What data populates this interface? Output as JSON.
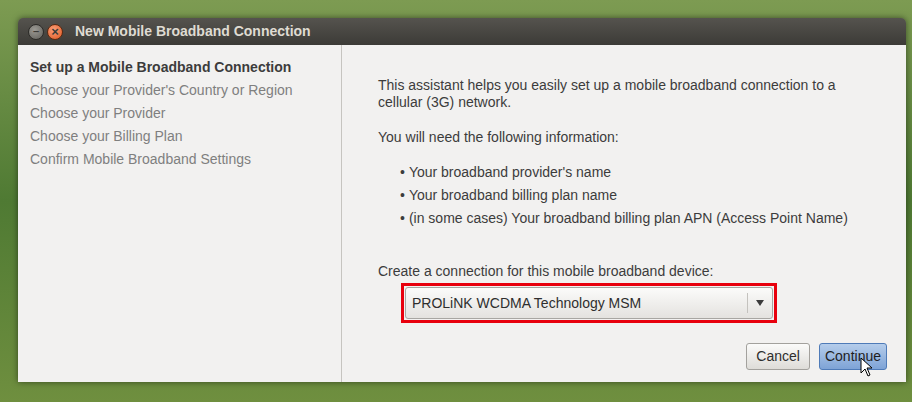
{
  "window": {
    "title": "New Mobile Broadband Connection",
    "buttons": [
      {
        "name": "minimize",
        "glyph": "–"
      },
      {
        "name": "close",
        "glyph": "×"
      }
    ]
  },
  "sidebar": {
    "items": [
      {
        "label": "Set up a Mobile Broadband Connection",
        "selected": true
      },
      {
        "label": "Choose your Provider's Country or Region",
        "selected": false
      },
      {
        "label": "Choose your Provider",
        "selected": false
      },
      {
        "label": "Choose your Billing Plan",
        "selected": false
      },
      {
        "label": "Confirm Mobile Broadband Settings",
        "selected": false
      }
    ]
  },
  "content": {
    "intro": "This assistant helps you easily set up a mobile broadband connection to a cellular (3G) network.",
    "need_label": "You will need the following information:",
    "bullet": "•",
    "requirements": [
      "Your broadband provider's name",
      "Your broadband billing plan name",
      "(in some cases) Your broadband billing plan APN (Access Point Name)"
    ],
    "device_label": "Create a connection for this mobile broadband device:",
    "device": {
      "value": "PROLiNK WCDMA Technology MSM",
      "highlighted": true
    }
  },
  "buttons": [
    {
      "label": "Cancel",
      "default": false
    },
    {
      "label": "Continue",
      "default": true
    }
  ]
}
